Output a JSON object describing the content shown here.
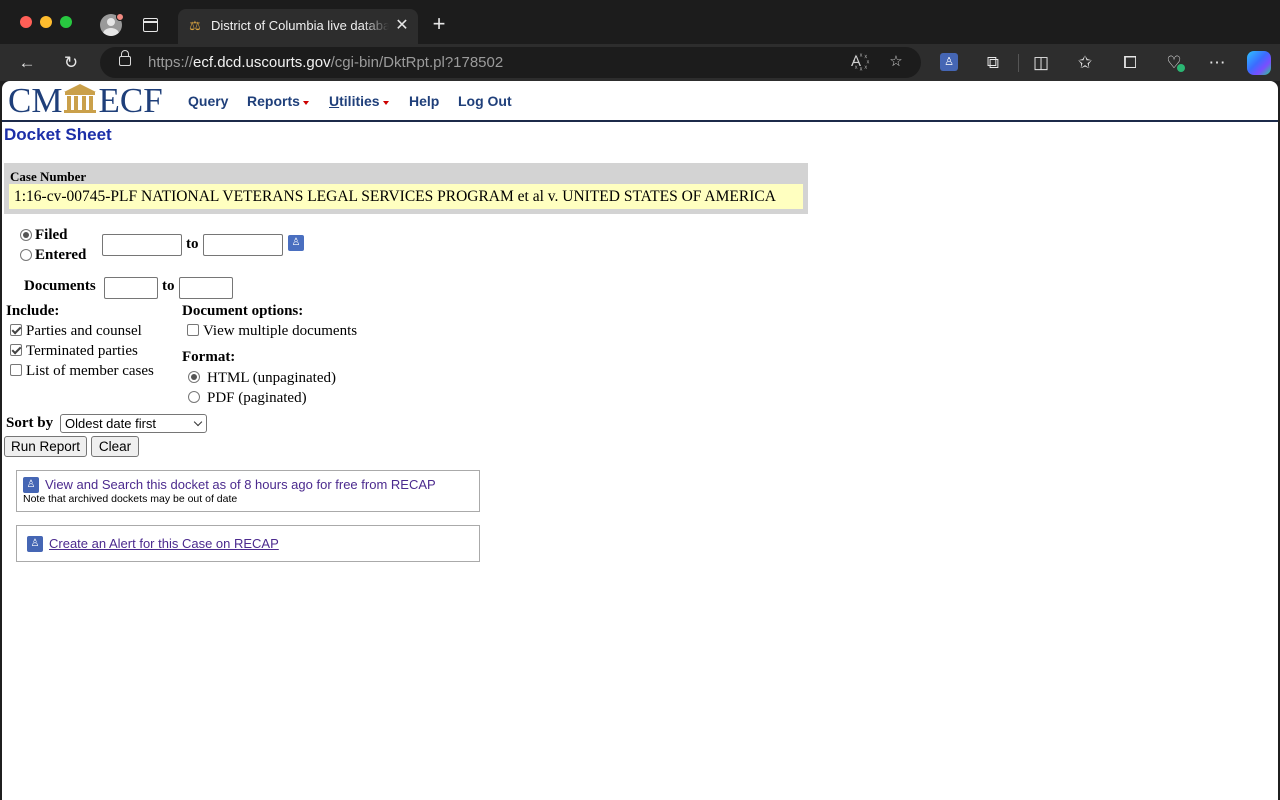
{
  "browser": {
    "tab_title": "District of Columbia live database",
    "tab_close": "✕",
    "new_tab": "+",
    "url_scheme": "https://",
    "url_host": "ecf.dcd.uscourts.gov",
    "url_path": "/cgi-bin/DktRpt.pl?178502"
  },
  "nav": {
    "logo_left": "CM",
    "logo_right": "ECF",
    "query": "Query",
    "reports": "Reports",
    "utilities_u": "U",
    "utilities_rest": "tilities",
    "help": "Help",
    "logout": "Log Out"
  },
  "page_title": "Docket Sheet",
  "case": {
    "label": "Case Number",
    "value": "1:16-cv-00745-PLF NATIONAL VETERANS LEGAL SERVICES PROGRAM et al v. UNITED STATES OF AMERICA"
  },
  "date_filter": {
    "filed_label": "Filed",
    "filed_selected": true,
    "entered_label": "Entered",
    "entered_selected": false,
    "to_label": "to",
    "from_value": "",
    "to_value": ""
  },
  "documents": {
    "label": "Documents",
    "to_label": "to",
    "from_value": "",
    "to_value": ""
  },
  "include": {
    "heading": "Include:",
    "items": [
      {
        "label": "Parties and counsel",
        "checked": true
      },
      {
        "label": "Terminated parties",
        "checked": true
      },
      {
        "label": "List of member cases",
        "checked": false
      }
    ]
  },
  "document_options": {
    "heading": "Document options:",
    "view_multiple": "View multiple documents",
    "view_multiple_checked": false
  },
  "format": {
    "heading": "Format:",
    "options": [
      {
        "label": "HTML (unpaginated)",
        "selected": true
      },
      {
        "label": "PDF (paginated)",
        "selected": false
      }
    ]
  },
  "sort": {
    "label": "Sort by",
    "selected": "Oldest date first"
  },
  "buttons": {
    "run_report": "Run Report",
    "clear": "Clear"
  },
  "recap": {
    "view_link": "View and Search this docket as of 8 hours ago for free from RECAP",
    "view_note": "Note that archived dockets may be out of date",
    "alert_link": "Create an Alert for this Case on RECAP"
  },
  "colors": {
    "nav_text": "#1f3f7a",
    "title": "#1c2fa8",
    "case_bg": "#ffffc0",
    "recap_link": "#4b2a8e",
    "recap_icon": "#4566b4"
  }
}
